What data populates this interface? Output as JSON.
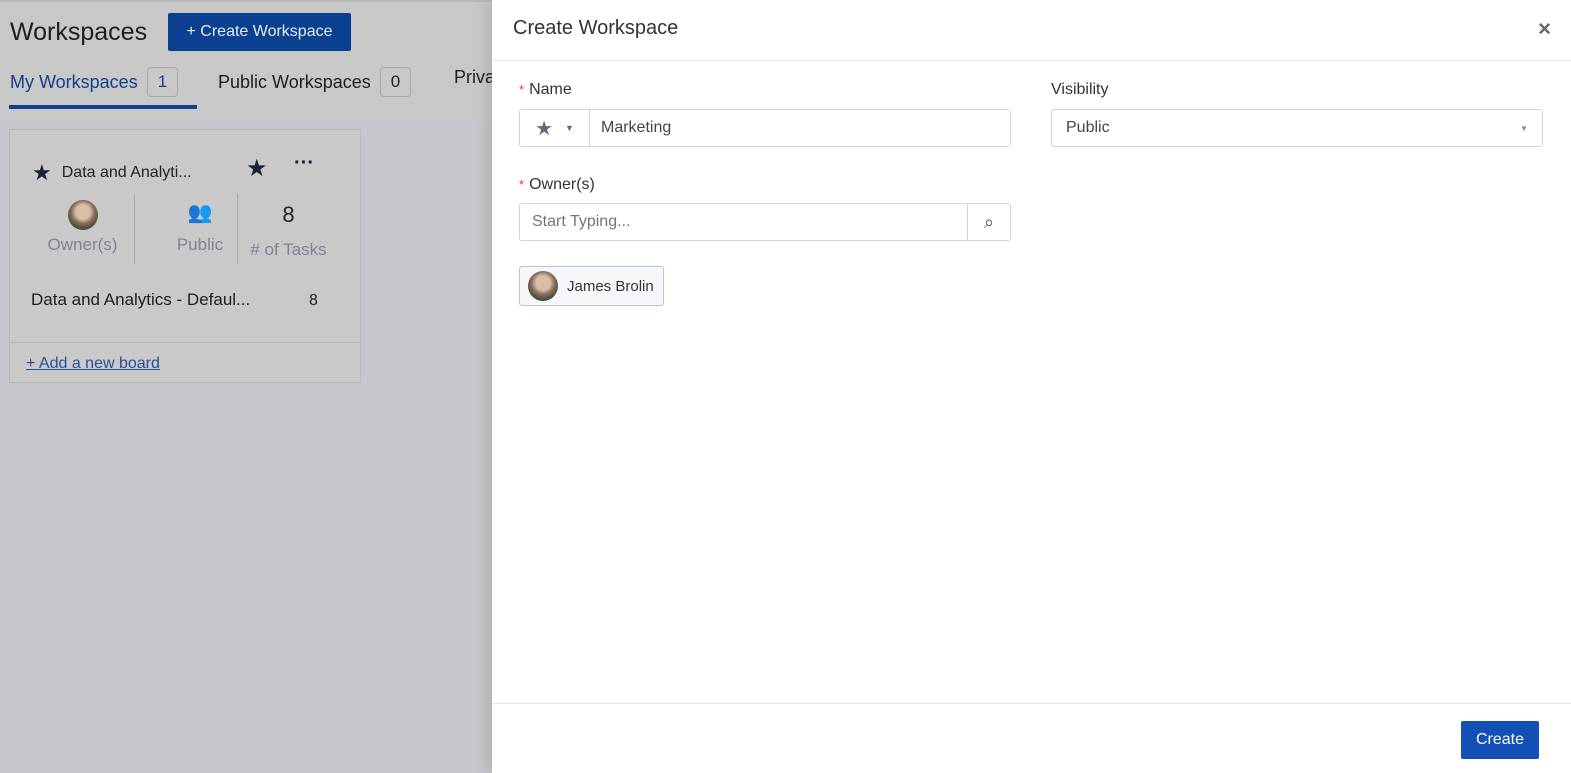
{
  "page": {
    "title": "Workspaces",
    "create_button": "+ Create Workspace",
    "tabs": [
      {
        "label": "My Workspaces",
        "count": "1"
      },
      {
        "label": "Public Workspaces",
        "count": "0"
      },
      {
        "label": "Priva"
      }
    ],
    "card": {
      "name": "Data and Analyti...",
      "owner_label": "Owner(s)",
      "visibility": "Public",
      "tasks_count": "8",
      "tasks_label": "# of Tasks",
      "board_name": "Data and Analytics - Defaul...",
      "board_count": "8",
      "add_board": "+ Add a new board"
    }
  },
  "modal": {
    "title": "Create Workspace",
    "close": "×",
    "name_label": "Name",
    "name_icon": "star-icon",
    "name_value": "Marketing",
    "visibility_label": "Visibility",
    "visibility_value": "Public",
    "owners_label": "Owner(s)",
    "owners_placeholder": "Start Typing...",
    "owners": [
      {
        "name": "James Brolin"
      }
    ],
    "create_button": "Create"
  },
  "colors": {
    "primary": "#1250b8",
    "required": "#e03b4c"
  }
}
